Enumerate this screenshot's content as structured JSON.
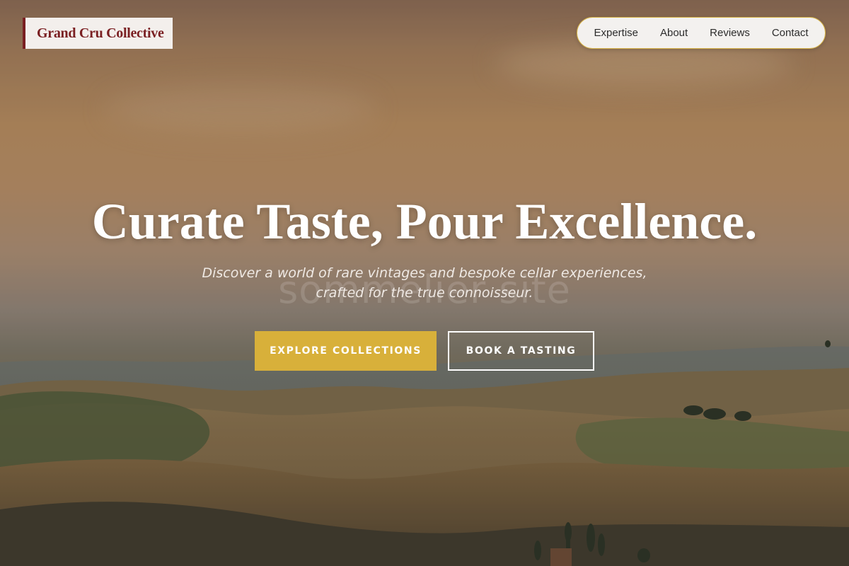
{
  "brand": {
    "name": "Grand Cru Collective"
  },
  "nav": {
    "items": [
      {
        "label": "Expertise"
      },
      {
        "label": "About"
      },
      {
        "label": "Reviews"
      },
      {
        "label": "Contact"
      }
    ]
  },
  "hero": {
    "headline": "Curate Taste, Pour Excellence.",
    "subline_1": "Discover a world of rare vintages and bespoke cellar experiences,",
    "subline_2": "crafted for the true connoisseur.",
    "watermark": "sommelier site",
    "primary_cta": "EXPLORE COLLECTIONS",
    "secondary_cta": "BOOK A TASTING",
    "background_image": "rolling-vineyard-hills-sunset"
  },
  "colors": {
    "brand_burgundy": "#7a1f22",
    "accent_gold": "#d8b03a",
    "nav_background": "#f3f1ef",
    "text_light": "#ffffff"
  }
}
